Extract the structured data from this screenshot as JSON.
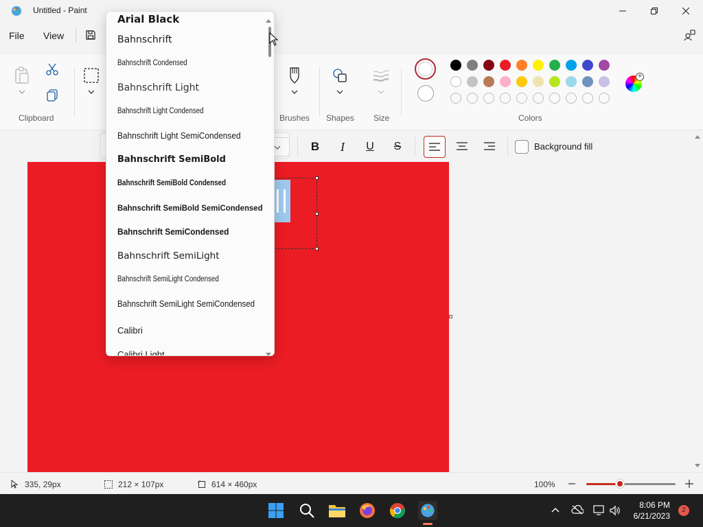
{
  "window": {
    "title": "Untitled - Paint"
  },
  "menu": {
    "file": "File",
    "view": "View"
  },
  "ribbon": {
    "clipboard": "Clipboard",
    "brushes": "Brushes",
    "shapes": "Shapes",
    "size": "Size",
    "colors": "Colors"
  },
  "palette": {
    "row1": [
      "#000000",
      "#7f7f7f",
      "#880015",
      "#ed1c24",
      "#ff7f27",
      "#fff200",
      "#22b14c",
      "#00a2e8",
      "#3f48cc",
      "#a349a4"
    ],
    "row2": [
      "#ffffff",
      "#c3c3c3",
      "#b97a57",
      "#ffaec9",
      "#ffc90e",
      "#efe4b0",
      "#b5e61d",
      "#99d9ea",
      "#7092be",
      "#c8bfe7"
    ]
  },
  "text_toolbar": {
    "background_fill": "Background fill"
  },
  "font_list": [
    "Arial Black",
    "Bahnschrift",
    "Bahnschrift Condensed",
    "Bahnschrift Light",
    "Bahnschrift Light Condensed",
    "Bahnschrift Light SemiCondensed",
    "Bahnschrift SemiBold",
    "Bahnschrift SemiBold Condensed",
    "Bahnschrift SemiBold SemiCondensed",
    "Bahnschrift SemiCondensed",
    "Bahnschrift SemiLight",
    "Bahnschrift SemiLight Condensed",
    "Bahnschrift SemiLight SemiCondensed",
    "Calibri",
    "Calibri Light"
  ],
  "status": {
    "cursor": "335, 29px",
    "selection": "212 × 107px",
    "canvas_size": "614 × 460px",
    "zoom": "100%"
  },
  "taskbar": {
    "time": "8:06 PM",
    "date": "6/21/2023",
    "notifications": "2"
  },
  "colors": {
    "canvas": "#ec1c24",
    "accent": "#c42b1c"
  }
}
